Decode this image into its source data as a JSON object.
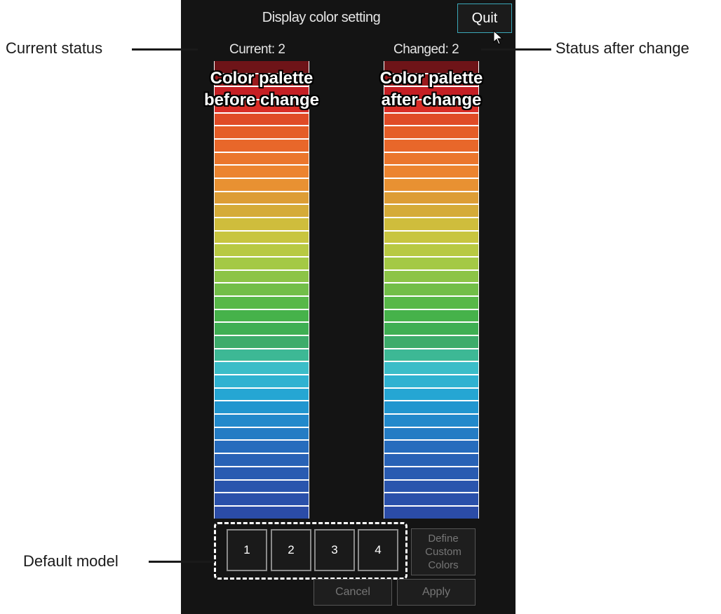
{
  "dialog": {
    "title": "Display color setting",
    "quit_label": "Quit",
    "current_label": "Current: 2",
    "changed_label": "Changed: 2"
  },
  "palette_before": {
    "caption_line1": "Color palette",
    "caption_line2": "before change",
    "colors": [
      "#6e1418",
      "#9b1b1e",
      "#c41f24",
      "#d92e27",
      "#e04b26",
      "#e55d27",
      "#e8672a",
      "#eb762c",
      "#ec842f",
      "#e89132",
      "#dd9d35",
      "#d5ab38",
      "#cfbd3c",
      "#c8c53f",
      "#b8c942",
      "#a4c945",
      "#8cc447",
      "#72be48",
      "#58b848",
      "#46b24a",
      "#3faf53",
      "#3dac6b",
      "#3db895",
      "#3bbdc8",
      "#2fb2d1",
      "#25a6d3",
      "#2196cf",
      "#2289cb",
      "#247cc4",
      "#266cbd",
      "#2862b6",
      "#295bb1",
      "#2a55ad",
      "#2a50aa",
      "#2b4ca7"
    ]
  },
  "palette_after": {
    "caption_line1": "Color palette",
    "caption_line2": "after change",
    "colors": [
      "#6e1418",
      "#9b1b1e",
      "#c41f24",
      "#d92e27",
      "#e04b26",
      "#e55d27",
      "#e8672a",
      "#eb762c",
      "#ec842f",
      "#e89132",
      "#dd9d35",
      "#d5ab38",
      "#cfbd3c",
      "#c8c53f",
      "#b8c942",
      "#a4c945",
      "#8cc447",
      "#72be48",
      "#58b848",
      "#46b24a",
      "#3faf53",
      "#3dac6b",
      "#3db895",
      "#3bbdc8",
      "#2fb2d1",
      "#25a6d3",
      "#2196cf",
      "#2289cb",
      "#247cc4",
      "#266cbd",
      "#2862b6",
      "#295bb1",
      "#2a55ad",
      "#2a50aa",
      "#2b4ca7"
    ]
  },
  "default_models": [
    "1",
    "2",
    "3",
    "4"
  ],
  "buttons": {
    "define_line1": "Define",
    "define_line2": "Custom",
    "define_line3": "Colors",
    "cancel": "Cancel",
    "apply": "Apply"
  },
  "callouts": {
    "current_status": "Current status",
    "status_after_change": "Status after change",
    "default_model": "Default model"
  }
}
